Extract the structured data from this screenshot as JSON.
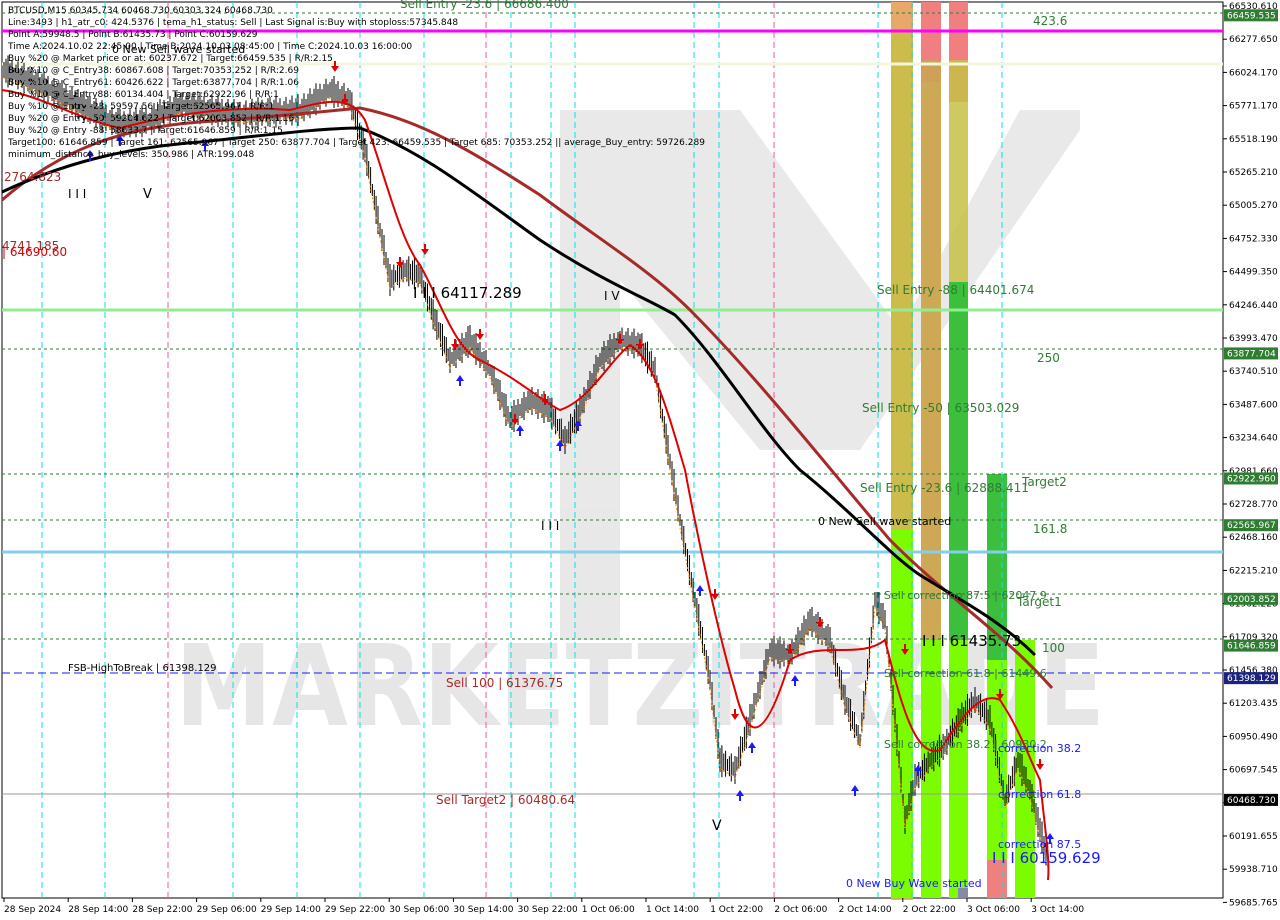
{
  "header": {
    "title": "BTCUSD,M15  60345.734 60468.730 60303.324 60468.730",
    "lines": [
      "Line:3493 | h1_atr_c0: 424.5376 | tema_h1_status: Sell | Last Signal is:Buy with stoploss:57345.848",
      "Point A:59948.5 | Point B:61435.73 | Point C:60159.629",
      "Time A:2024.10.02 22:45:00 | Time B:2024.10.03 08:45:00 | Time C:2024.10.03 16:00:00",
      "Buy %20 @ Market price or at: 60237.672 | Target:66459.535 | R/R:2.15",
      "Buy %10 @ C_Entry38: 60867.608 | Target:70353.252 | R/R:2.69",
      "Buy %10 @ C_Entry61: 60426.622 | Target:63877.704 | R/R:1.06",
      "Buy %10 @ C_Entry88: 60134.404 | Target:62922.96 | R/R:1",
      "Buy %10 @ Entry -23: 59597.56 | Target:62565.967 | R/R:1",
      "Buy %20 @ Entry -50: 59204.622 | Target:62003.852 | R/R:1.16",
      "Buy %20 @ Entry -88: 58633.7 | Target:61646.859 | R/R:1.15",
      "Target100: 61646.859 | Target 161: 62565.967 | Target 250: 63877.704 | Target 423: 66459.535 | Target 685: 70353.252 || average_Buy_entry: 59726.289",
      "minimum_distance_buy_levels: 350.986 | ATR:199.048"
    ]
  },
  "watermark": "MARKETZITRADE",
  "price_axis": {
    "ticks": [
      "66530.610",
      "66277.650",
      "66024.170",
      "65771.170",
      "65518.190",
      "65265.210",
      "65005.270",
      "64752.330",
      "64499.350",
      "64246.440",
      "63993.470",
      "63740.510",
      "63487.600",
      "63234.640",
      "62981.660",
      "62728.770",
      "62468.160",
      "62215.210",
      "61962.220",
      "61709.320",
      "61456.380",
      "61203.435",
      "60950.490",
      "60697.545",
      "60444.600",
      "60191.655",
      "59938.710",
      "59685.765"
    ],
    "markers": [
      {
        "label": "66459.535",
        "color": "#2e7d32"
      },
      {
        "label": "63877.704",
        "color": "#2e7d32"
      },
      {
        "label": "62922.960",
        "color": "#2e7d32"
      },
      {
        "label": "62565.967",
        "color": "#2e7d32"
      },
      {
        "label": "62003.852",
        "color": "#2e7d32"
      },
      {
        "label": "61646.859",
        "color": "#2e7d32"
      },
      {
        "label": "61398.129",
        "color": "#1a237e"
      },
      {
        "label": "60468.730",
        "color": "#000000"
      }
    ]
  },
  "time_axis": [
    "28 Sep 2024",
    "28 Sep 14:00",
    "28 Sep 22:00",
    "29 Sep 06:00",
    "29 Sep 14:00",
    "29 Sep 22:00",
    "30 Sep 06:00",
    "30 Sep 14:00",
    "30 Sep 22:00",
    "1 Oct 06:00",
    "1 Oct 14:00",
    "1 Oct 22:00",
    "2 Oct 06:00",
    "2 Oct 14:00",
    "2 Oct 22:00",
    "3 Oct 06:00",
    "3 Oct 14:00"
  ],
  "annotations": {
    "sell_entry_top": "Sell Entry -23.6 | 66686.400",
    "new_sell_wave_top": "0 New Sell wave started",
    "fib_2764": "2764.823",
    "fib_4741": "4741.185",
    "fib_64690": "| 64690.60",
    "marker_iii_1": "I I I",
    "marker_v_1": "V",
    "level_64117": "I I I 64117.289",
    "marker_iv": "I V",
    "marker_iii_2": "I I I",
    "sell_entry_88": "Sell Entry -88 | 64401.674",
    "sell_entry_50": "Sell Entry -50 | 63503.029",
    "sell_entry_236": "Sell Entry -23.6 | 62888.411",
    "new_sell_wave_mid": "0 New Sell wave started",
    "sell_corr_875": "Sell correction 87.5 | 62047.9",
    "level_61435": "I I I 61435.73",
    "sell_corr_618": "Sell correction 61.8 | 61449.6",
    "sell_corr_382": "Sell correction 38.2 | 60930.2",
    "fsb": "FSB-HighToBreak | 61398.129",
    "sell_100": "Sell 100 | 61376.75",
    "sell_target2": "Sell Target2 | 60480.64",
    "marker_v_2": "V",
    "new_buy_wave": "0 New Buy Wave started",
    "correction_382": "correction 38.2",
    "correction_618": "correction 61.8",
    "correction_875": "correction 87.5",
    "level_60159": "I I I 60159.629",
    "t_4236": "423.6",
    "t_250": "250",
    "t_target2": "Target2",
    "t_1618": "161.8",
    "t_target1": "Target1",
    "t_100": "100"
  },
  "colors": {
    "magenta": "#ff00ff",
    "light_green_line": "#90ee90",
    "light_blue_line": "#87ceeb",
    "fsb_line": "#1a1aff",
    "dark_green": "#2e7d32",
    "maroon": "#a52a2a",
    "black_ma": "#000000",
    "red_ma": "#e00000",
    "cyan_grid": "#00e5ee",
    "pink_grid": "#ff4da6"
  }
}
